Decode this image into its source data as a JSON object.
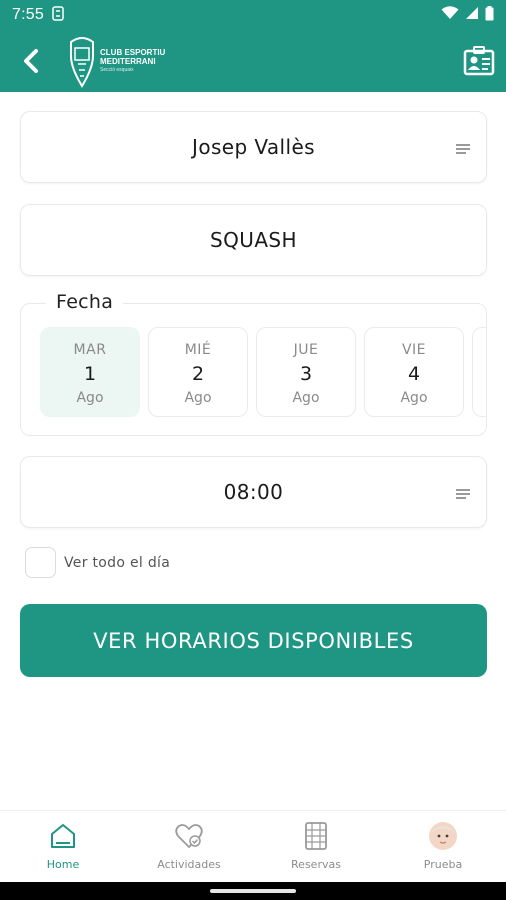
{
  "status_bar": {
    "time": "7:55"
  },
  "header": {
    "logo": {
      "line1": "CLUB ESPORTIU",
      "line2": "MEDITERRANI",
      "line3": "Secció esquaix"
    }
  },
  "player": {
    "value": "Josep Vallès"
  },
  "sport": {
    "value": "SQUASH"
  },
  "date_picker": {
    "legend": "Fecha",
    "days": [
      {
        "dow": "MAR",
        "num": "1",
        "mon": "Ago",
        "selected": true
      },
      {
        "dow": "MIÉ",
        "num": "2",
        "mon": "Ago",
        "selected": false
      },
      {
        "dow": "JUE",
        "num": "3",
        "mon": "Ago",
        "selected": false
      },
      {
        "dow": "VIE",
        "num": "4",
        "mon": "Ago",
        "selected": false
      }
    ]
  },
  "time_select": {
    "value": "08:00"
  },
  "all_day": {
    "label": "Ver todo el día",
    "checked": false
  },
  "cta": {
    "label": "VER HORARIOS DISPONIBLES"
  },
  "bottom_nav": {
    "items": [
      {
        "label": "Home",
        "icon": "home-icon",
        "active": true
      },
      {
        "label": "Actividades",
        "icon": "heart-check-icon",
        "active": false
      },
      {
        "label": "Reservas",
        "icon": "calendar-grid-icon",
        "active": false
      },
      {
        "label": "Prueba",
        "icon": "avatar",
        "active": false
      }
    ]
  },
  "colors": {
    "primary": "#1f9683",
    "selected_day_bg": "#ecf6f3",
    "text": "#1a1a1a",
    "muted": "#8a8a8a"
  }
}
